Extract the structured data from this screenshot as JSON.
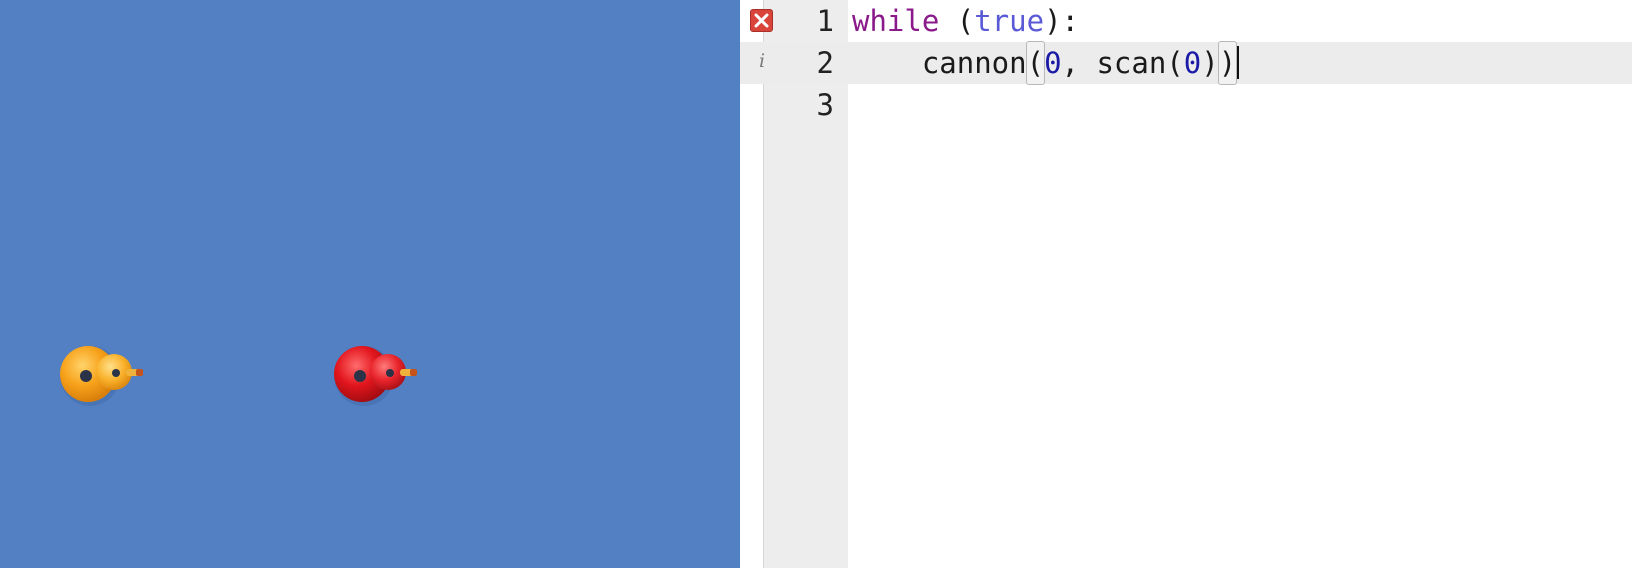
{
  "arena": {
    "background": "#5280c2",
    "robots": [
      {
        "name": "orange-robot",
        "body_color": "#f7a21b",
        "icon": "robot-tank-icon"
      },
      {
        "name": "red-robot",
        "body_color": "#e2151d",
        "icon": "robot-tank-icon"
      }
    ]
  },
  "editor": {
    "lines": [
      {
        "number": "1",
        "marker": "error-icon",
        "tokens": [
          "while",
          " (",
          "true",
          "):"
        ]
      },
      {
        "number": "2",
        "marker": "info-icon",
        "indent": "    ",
        "tokens": [
          "cannon",
          "(",
          "0",
          ", scan(",
          "0",
          ")",
          ")"
        ]
      },
      {
        "number": "3",
        "marker": "",
        "tokens": []
      }
    ],
    "info_glyph": "i",
    "active_line": "2"
  }
}
